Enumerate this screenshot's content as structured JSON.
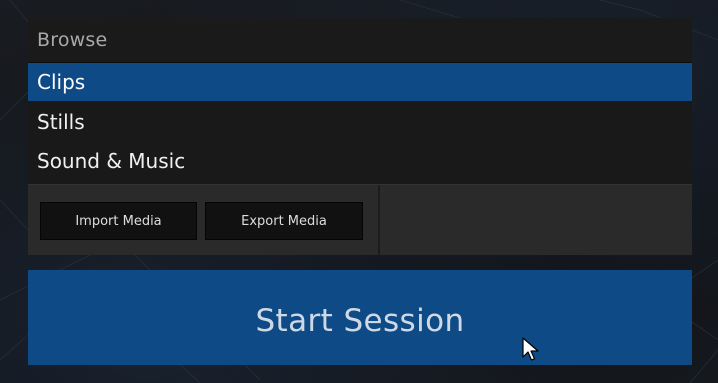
{
  "browse": {
    "header": "Browse",
    "items": [
      {
        "label": "Clips",
        "selected": true
      },
      {
        "label": "Stills",
        "selected": false
      },
      {
        "label": "Sound & Music",
        "selected": false
      }
    ]
  },
  "toolbar": {
    "import_label": "Import Media",
    "export_label": "Export Media"
  },
  "start": {
    "label": "Start Session"
  },
  "colors": {
    "selection": "#0e4a86",
    "panel_bg": "#1a1a1a",
    "toolbar_bg": "#2a2a2a",
    "button_bg": "#111111",
    "start_bg": "#0e4a86"
  },
  "icons": {
    "cursor": "mouse-pointer-icon"
  }
}
